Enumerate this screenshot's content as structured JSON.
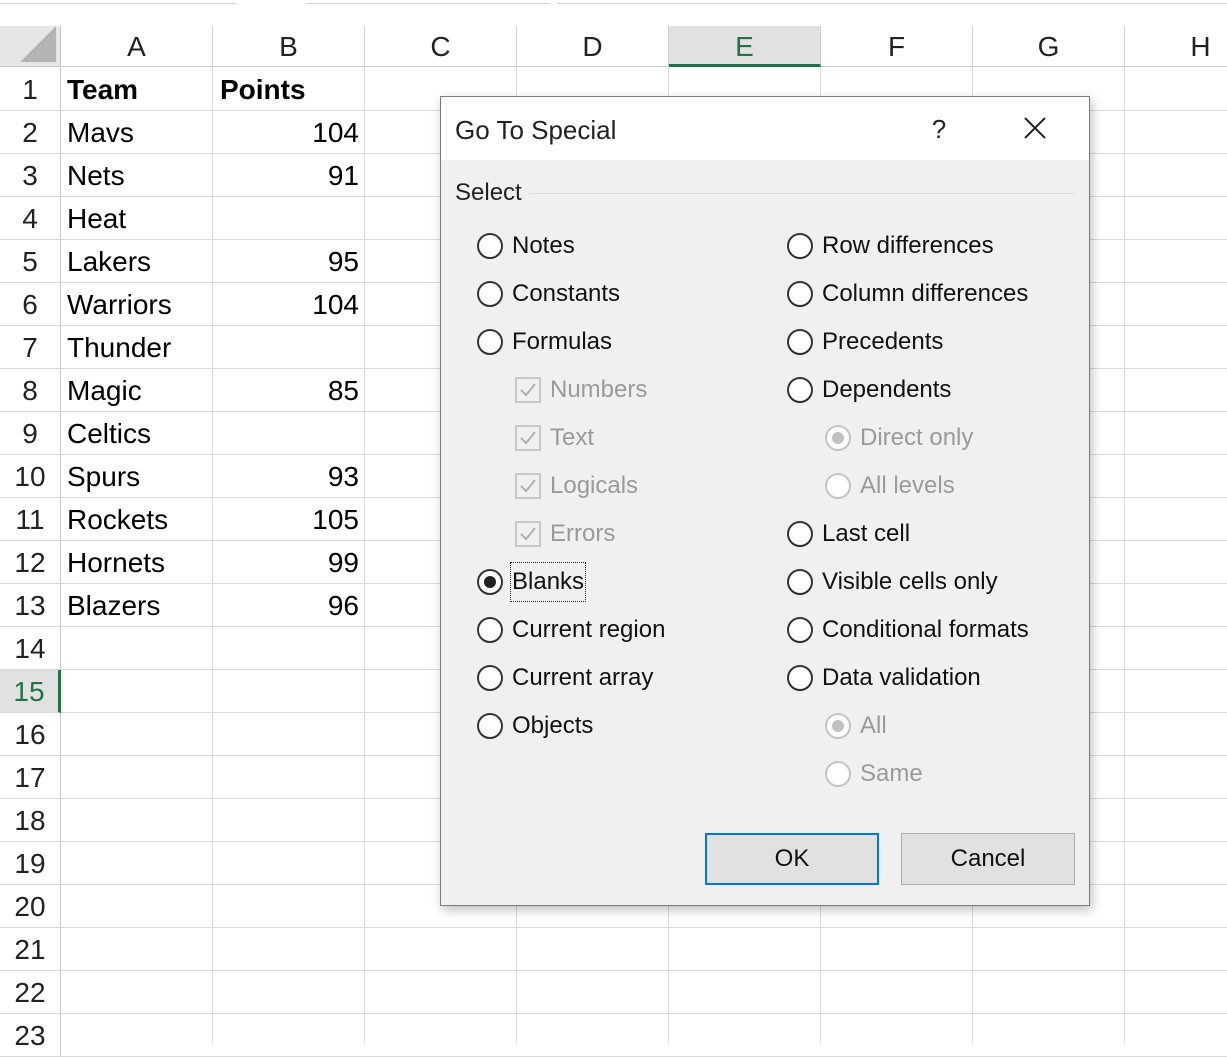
{
  "sheet": {
    "columns": [
      "A",
      "B",
      "C",
      "D",
      "E",
      "F",
      "G",
      "H"
    ],
    "selected_column": "E",
    "rows": [
      "1",
      "2",
      "3",
      "4",
      "5",
      "6",
      "7",
      "8",
      "9",
      "10",
      "11",
      "12",
      "13",
      "14",
      "15",
      "16",
      "17",
      "18",
      "19",
      "20",
      "21",
      "22",
      "23"
    ],
    "selected_row": "15",
    "header_row": {
      "a": "Team",
      "b": "Points"
    },
    "data": [
      {
        "a": "Mavs",
        "b": "104"
      },
      {
        "a": "Nets",
        "b": "91"
      },
      {
        "a": "Heat",
        "b": ""
      },
      {
        "a": "Lakers",
        "b": "95"
      },
      {
        "a": "Warriors",
        "b": "104"
      },
      {
        "a": "Thunder",
        "b": ""
      },
      {
        "a": "Magic",
        "b": "85"
      },
      {
        "a": "Celtics",
        "b": ""
      },
      {
        "a": "Spurs",
        "b": "93"
      },
      {
        "a": "Rockets",
        "b": "105"
      },
      {
        "a": "Hornets",
        "b": "99"
      },
      {
        "a": "Blazers",
        "b": "96"
      }
    ]
  },
  "dialog": {
    "title": "Go To Special",
    "help_label": "?",
    "group_label": "Select",
    "left_options": [
      {
        "label": "Notes",
        "type": "radio",
        "checked": false,
        "disabled": false,
        "indent": false
      },
      {
        "label": "Constants",
        "type": "radio",
        "checked": false,
        "disabled": false,
        "indent": false
      },
      {
        "label": "Formulas",
        "type": "radio",
        "checked": false,
        "disabled": false,
        "indent": false
      },
      {
        "label": "Numbers",
        "type": "checkbox",
        "checked": true,
        "disabled": true,
        "indent": true
      },
      {
        "label": "Text",
        "type": "checkbox",
        "checked": true,
        "disabled": true,
        "indent": true
      },
      {
        "label": "Logicals",
        "type": "checkbox",
        "checked": true,
        "disabled": true,
        "indent": true
      },
      {
        "label": "Errors",
        "type": "checkbox",
        "checked": true,
        "disabled": true,
        "indent": true
      },
      {
        "label": "Blanks",
        "type": "radio",
        "checked": true,
        "disabled": false,
        "indent": false
      },
      {
        "label": "Current region",
        "type": "radio",
        "checked": false,
        "disabled": false,
        "indent": false
      },
      {
        "label": "Current array",
        "type": "radio",
        "checked": false,
        "disabled": false,
        "indent": false
      },
      {
        "label": "Objects",
        "type": "radio",
        "checked": false,
        "disabled": false,
        "indent": false
      }
    ],
    "right_options": [
      {
        "label": "Row differences",
        "type": "radio",
        "checked": false,
        "disabled": false,
        "indent": false
      },
      {
        "label": "Column differences",
        "type": "radio",
        "checked": false,
        "disabled": false,
        "indent": false
      },
      {
        "label": "Precedents",
        "type": "radio",
        "checked": false,
        "disabled": false,
        "indent": false
      },
      {
        "label": "Dependents",
        "type": "radio",
        "checked": false,
        "disabled": false,
        "indent": false
      },
      {
        "label": "Direct only",
        "type": "radio",
        "checked": true,
        "disabled": true,
        "indent": true
      },
      {
        "label": "All levels",
        "type": "radio",
        "checked": false,
        "disabled": true,
        "indent": true
      },
      {
        "label": "Last cell",
        "type": "radio",
        "checked": false,
        "disabled": false,
        "indent": false
      },
      {
        "label": "Visible cells only",
        "type": "radio",
        "checked": false,
        "disabled": false,
        "indent": false
      },
      {
        "label": "Conditional formats",
        "type": "radio",
        "checked": false,
        "disabled": false,
        "indent": false
      },
      {
        "label": "Data validation",
        "type": "radio",
        "checked": false,
        "disabled": false,
        "indent": false
      },
      {
        "label": "All",
        "type": "radio",
        "checked": true,
        "disabled": true,
        "indent": true
      },
      {
        "label": "Same",
        "type": "radio",
        "checked": false,
        "disabled": true,
        "indent": true
      }
    ],
    "ok_label": "OK",
    "cancel_label": "Cancel"
  },
  "colors": {
    "accent_green": "#217346",
    "default_button_border": "#0078d7"
  }
}
